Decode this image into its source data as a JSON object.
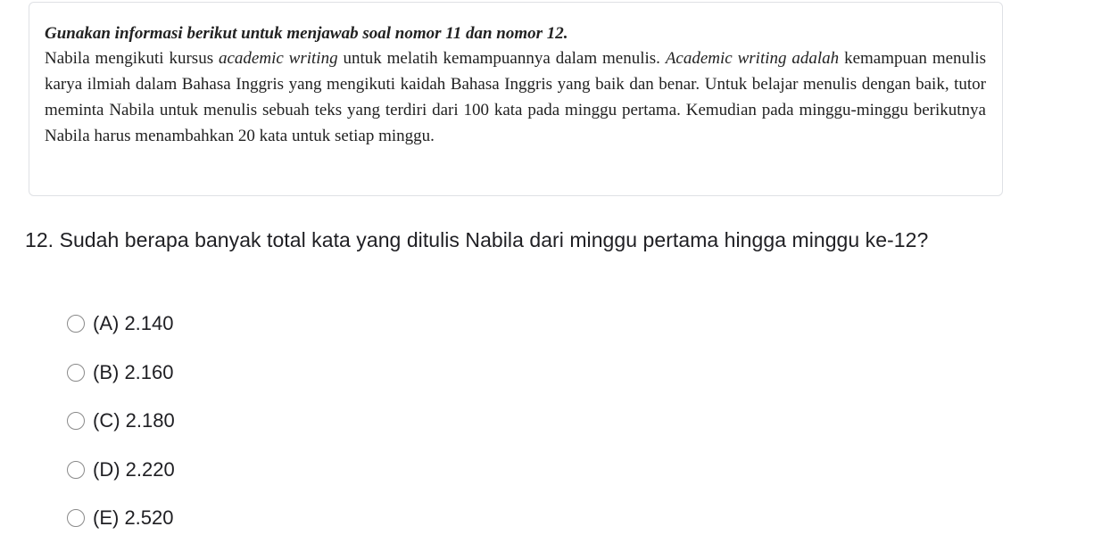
{
  "info_card": {
    "heading": "Gunakan informasi berikut untuk menjawab soal nomor 11 dan nomor 12.",
    "paragraph": {
      "part1": "Nabila mengikuti kursus ",
      "italic1": "academic writing",
      "part2": " untuk melatih kemampuannya dalam menulis. ",
      "italic2": "Academic writing adalah",
      "part3": " kemampuan menulis karya ilmiah dalam Bahasa Inggris yang mengikuti kaidah Bahasa Inggris yang baik dan benar. Untuk belajar menulis dengan baik, tutor meminta Nabila untuk menulis sebuah teks yang terdiri dari 100 kata pada minggu pertama. Kemudian pada minggu-minggu berikutnya Nabila harus menambahkan 20 kata untuk setiap minggu."
    }
  },
  "question": {
    "text": "12. Sudah berapa banyak total kata yang ditulis Nabila dari minggu pertama hingga minggu ke-12?"
  },
  "options": [
    {
      "label": "(A) 2.140",
      "selected": false
    },
    {
      "label": "(B) 2.160",
      "selected": false
    },
    {
      "label": "(C) 2.180",
      "selected": false
    },
    {
      "label": "(D) 2.220",
      "selected": false
    },
    {
      "label": "(E) 2.520",
      "selected": false
    }
  ]
}
